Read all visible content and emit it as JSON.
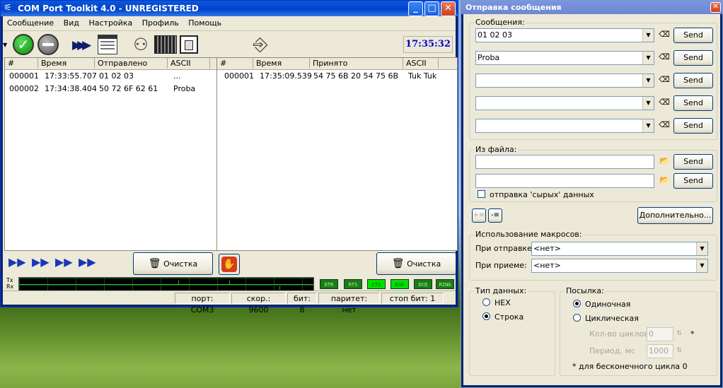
{
  "main_window": {
    "title": "COM Port Toolkit 4.0 - UNREGISTERED",
    "menu": [
      "Сообщение",
      "Вид",
      "Настройка",
      "Профиль",
      "Помощь"
    ],
    "clock": "17:35:32",
    "sent": {
      "columns": [
        "#",
        "Время",
        "Отправлено",
        "ASCII"
      ],
      "rows": [
        {
          "n": "000001",
          "time": "17:33:55.707",
          "data": "01 02 03",
          "ascii": "..."
        },
        {
          "n": "000002",
          "time": "17:34:38.404",
          "data": "50 72 6F 62 61",
          "ascii": "Proba"
        }
      ],
      "clear_label": "Очистка"
    },
    "received": {
      "columns": [
        "#",
        "Время",
        "Принято",
        "ASCII"
      ],
      "rows": [
        {
          "n": "000001",
          "time": "17:35:09.539",
          "data": "54 75 6B 20 54 75 6B",
          "ascii": "Tuk Tuk"
        }
      ],
      "clear_label": "Очистка"
    },
    "signal_labels": {
      "tx": "Tx",
      "rx": "Rx"
    },
    "leds": [
      {
        "label": "DTR",
        "on": false
      },
      {
        "label": "RTS",
        "on": false
      },
      {
        "label": "CTS",
        "on": true
      },
      {
        "label": "DSR",
        "on": true
      },
      {
        "label": "DCD",
        "on": false
      },
      {
        "label": "RING",
        "on": false
      }
    ],
    "status": {
      "port": "порт: COM3",
      "speed": "скор.: 9600",
      "bits": "бит: 8",
      "parity": "паритет: нет",
      "stopbits": "стоп бит: 1"
    }
  },
  "send_window": {
    "title": "Отправка сообщения",
    "messages_group": "Сообщения:",
    "messages": [
      "01 02 03",
      "Proba",
      "",
      "",
      ""
    ],
    "send_label": "Send",
    "file_group": "Из файла:",
    "files": [
      "",
      ""
    ],
    "raw_checkbox": "отправка 'сырых' данных",
    "more_button": "Дополнительно...",
    "macro_group": "Использование макросов:",
    "on_send_label": "При отправке:",
    "on_send_value": "<нет>",
    "on_receive_label": "При приеме:",
    "on_receive_value": "<нет>",
    "datatype_group": "Тип данных:",
    "hex": "HEX",
    "string": "Строка",
    "datatype_selected": "Строка",
    "mode_group": "Посылка:",
    "single": "Одиночная",
    "cyclic": "Циклическая",
    "mode_selected": "Одиночная",
    "cycles_label": "Кол-во циклов",
    "cycles_value": "0",
    "period_label": "Период, мс",
    "period_value": "1000",
    "asterisk": "*",
    "infinite_note": "* для бесконечного цикла  0"
  }
}
